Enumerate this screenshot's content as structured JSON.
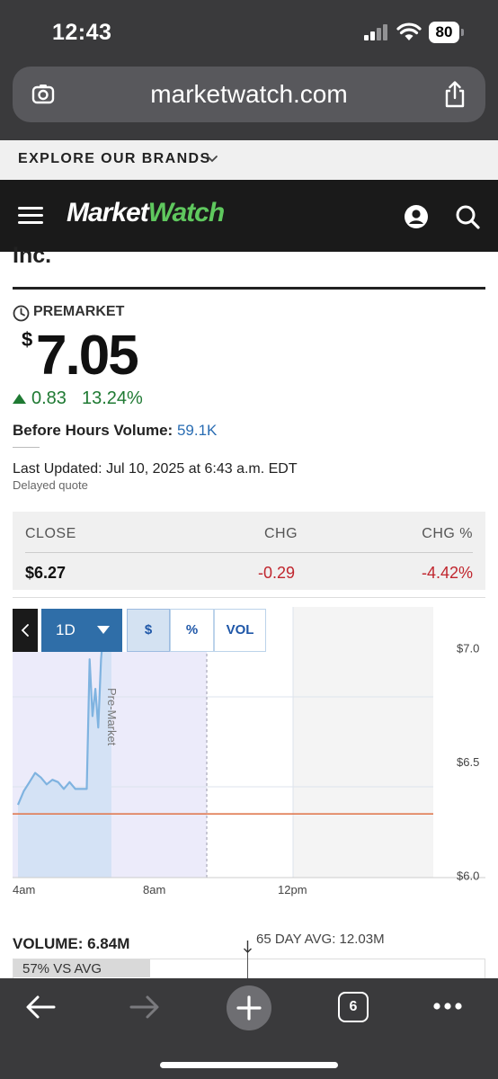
{
  "status_bar": {
    "time": "12:43",
    "battery": "80"
  },
  "browser": {
    "url": "marketwatch.com",
    "tab_count": "6"
  },
  "explore_bar": {
    "label": "EXPLORE OUR BRANDS"
  },
  "header": {
    "logo_part1": "Market",
    "logo_part2": "Watch"
  },
  "quote": {
    "company_tail": "Inc.",
    "session_label": "PREMARKET",
    "currency_symbol": "$",
    "price": "7.05",
    "change": "0.83",
    "change_percent": "13.24%",
    "before_hours_volume_label": "Before Hours Volume:",
    "before_hours_volume": "59.1K",
    "last_updated": "Last Updated: Jul 10, 2025 at 6:43 a.m. EDT",
    "delayed_note": "Delayed quote"
  },
  "close_table": {
    "headers": [
      "CLOSE",
      "CHG",
      "CHG %"
    ],
    "values": [
      "$6.27",
      "-0.29",
      "-4.42%"
    ]
  },
  "chart_controls": {
    "range": "1D",
    "buttons": [
      "$",
      "%",
      "VOL"
    ]
  },
  "chart_data": {
    "type": "line",
    "series": [
      {
        "x": [
          "4:00",
          "4:10",
          "4:20",
          "4:30",
          "4:40",
          "4:50",
          "5:00",
          "5:10",
          "5:20",
          "5:30",
          "5:40",
          "5:50",
          "6:00",
          "6:05",
          "6:10",
          "6:15",
          "6:20",
          "6:25",
          "6:30",
          "6:35",
          "6:40",
          "6:43"
        ],
        "values": [
          6.31,
          6.37,
          6.41,
          6.45,
          6.43,
          6.4,
          6.42,
          6.41,
          6.38,
          6.41,
          6.38,
          6.38,
          6.38,
          6.95,
          6.7,
          6.82,
          6.65,
          6.95,
          7.1,
          7.12,
          7.05,
          7.05
        ]
      }
    ],
    "previous_close": 6.27,
    "y_ticks": [
      "$7.0",
      "$6.5",
      "$6.0"
    ],
    "y_tick_values": [
      7.0,
      6.5,
      6.0
    ],
    "x_ticks": [
      "4am",
      "8am",
      "12pm"
    ],
    "ylim": [
      5.99,
      7.18
    ],
    "session_annotation": "Pre-Market",
    "grid": true,
    "colors": {
      "line": "#7fb3e0",
      "fill": "#d4e2f5",
      "premarket_bg": "#ecebfa",
      "close_line": "#e07a52",
      "afterhours_bg": "#f4f4f4"
    }
  },
  "volume": {
    "label": "VOLUME: 6.84M",
    "avg_label": "65 DAY AVG: 12.03M",
    "vs_avg_label": "57% VS AVG",
    "vs_avg_fraction": 0.57
  },
  "colors": {
    "positive": "#1f7a33",
    "negative": "#c0262e",
    "link": "#2a6db3",
    "dark_header": "#1a1a1a",
    "logo_accent": "#5fc85e"
  }
}
